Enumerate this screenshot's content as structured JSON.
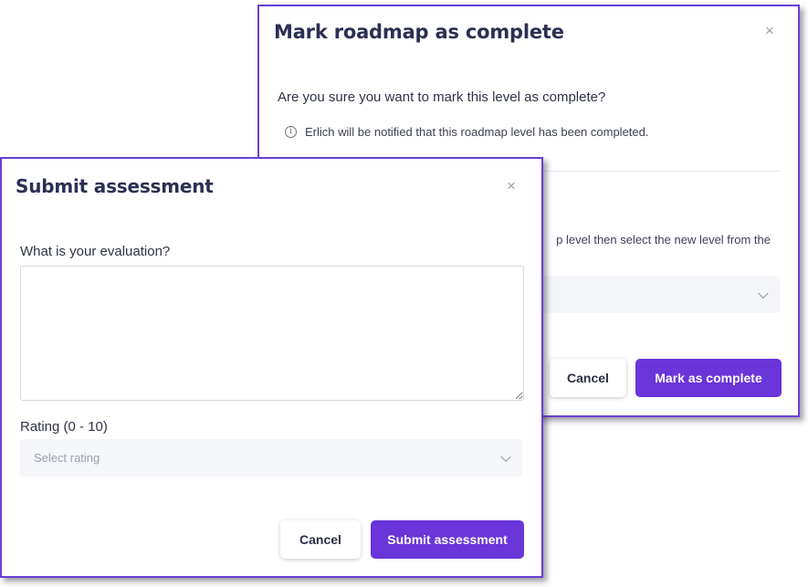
{
  "mark_modal": {
    "title": "Mark roadmap as complete",
    "close_glyph": "×",
    "question": "Are you sure you want to mark this level as complete?",
    "info_icon_glyph": "i",
    "info_text": "Erlich will be notified that this roadmap level has been completed.",
    "partial_text": "p level then select the new level from the",
    "cancel_label": "Cancel",
    "confirm_label": "Mark as complete"
  },
  "assessment_modal": {
    "title": "Submit assessment",
    "close_glyph": "×",
    "evaluation_label": "What is your evaluation?",
    "evaluation_value": "",
    "rating_label": "Rating (0 - 10)",
    "rating_placeholder": "Select rating",
    "cancel_label": "Cancel",
    "submit_label": "Submit assessment"
  },
  "colors": {
    "accent": "#6a35d9",
    "modal_border": "#6a3fd4",
    "select_bg": "#f4f6f9"
  }
}
